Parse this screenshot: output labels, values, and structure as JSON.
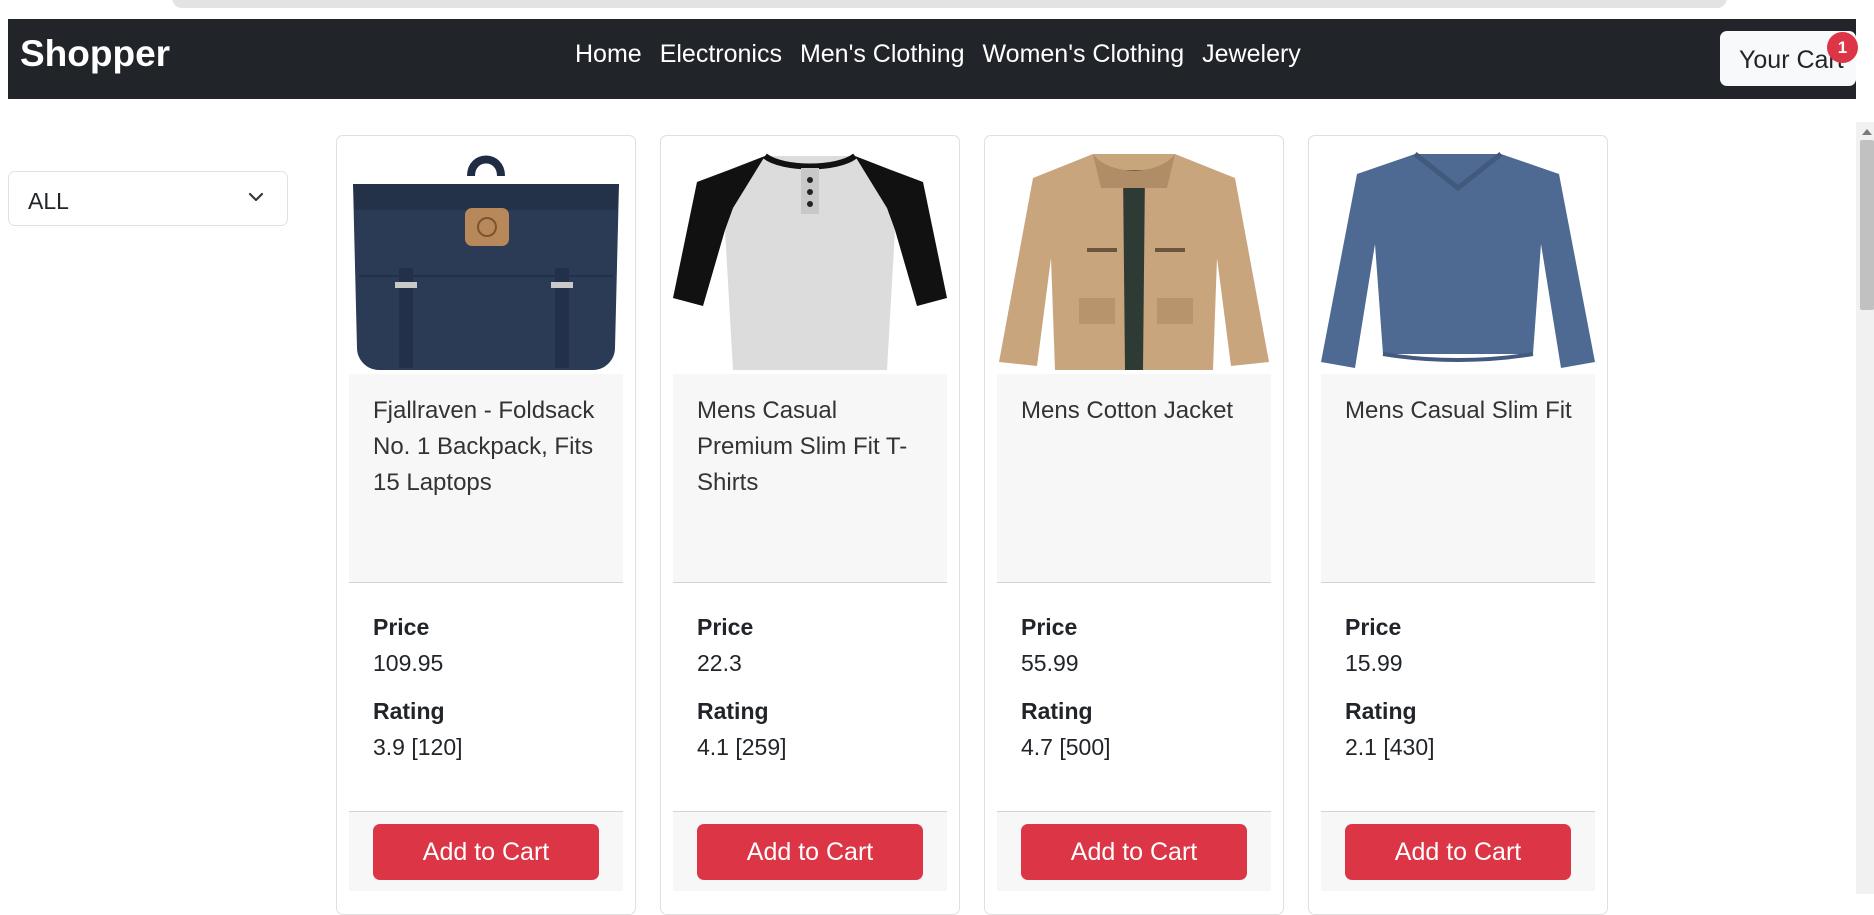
{
  "navbar": {
    "brand": "Shopper",
    "links": [
      "Home",
      "Electronics",
      "Men's Clothing",
      "Women's Clothing",
      "Jewelery"
    ],
    "cart_label": "Your Cart",
    "cart_count": "1"
  },
  "filter": {
    "selected": "ALL"
  },
  "labels": {
    "price": "Price",
    "rating": "Rating",
    "add_to_cart": "Add to Cart"
  },
  "products": [
    {
      "title": "Fjallraven - Foldsack No. 1 Backpack, Fits 15 Laptops",
      "price": "109.95",
      "rating": "3.9 [120]",
      "image_icon": "backpack"
    },
    {
      "title": "Mens Casual Premium Slim Fit T-Shirts",
      "price": "22.3",
      "rating": "4.1 [259]",
      "image_icon": "raglan-tshirt"
    },
    {
      "title": "Mens Cotton Jacket",
      "price": "55.99",
      "rating": "4.7 [500]",
      "image_icon": "jacket"
    },
    {
      "title": "Mens Casual Slim Fit",
      "price": "15.99",
      "rating": "2.1 [430]",
      "image_icon": "longsleeve-shirt"
    }
  ],
  "colors": {
    "navbar": "#212529",
    "accent": "#dc3545",
    "card_band": "#f7f7f7"
  }
}
